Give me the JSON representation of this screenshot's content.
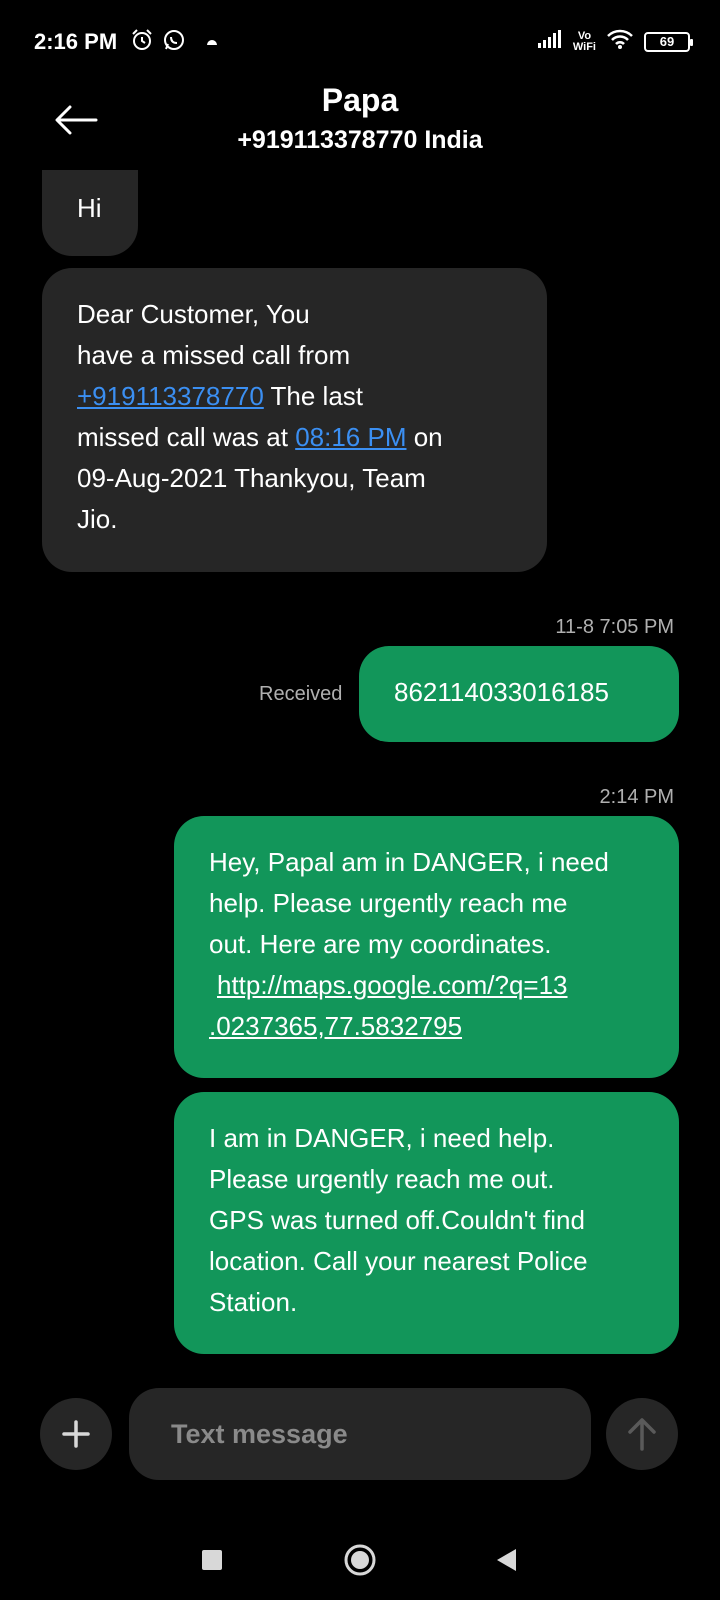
{
  "status_bar": {
    "time": "2:16 PM",
    "icons": [
      "alarm-icon",
      "whatsapp-icon",
      "notification-dot-icon",
      "signal-icon",
      "vowifi-icon",
      "wifi-icon",
      "battery-icon"
    ],
    "vowifi_label_top": "Vo",
    "vowifi_label_bottom": "WiFi",
    "battery_level": "69"
  },
  "header": {
    "contact_name": "Papa",
    "contact_number": "+919113378770 India",
    "back_icon": "arrow-left-icon"
  },
  "messages": {
    "incoming_1": {
      "text": "Hi"
    },
    "incoming_2": {
      "line1": "Dear Customer, You",
      "line2": "have a missed call from",
      "phone_link": "+919113378770",
      "line3_rest": " The last",
      "line4_start": "missed call was at ",
      "time_link": "08:16 PM",
      "line4_end": " on",
      "line5": "09-Aug-2021 Thankyou, Team",
      "line6": "Jio."
    },
    "timestamp_1": "11-8 7:05 PM",
    "outgoing_1": {
      "status": "Received",
      "text": "862114033016185"
    },
    "timestamp_2": "2:14 PM",
    "outgoing_2": {
      "line1": "Hey, Papal am in DANGER, i need",
      "line2": "help. Please urgently reach me",
      "line3": "out. Here are my coordinates.",
      "link_line1": "http://maps.google.com/?q=13",
      "link_line2": ".0237365,77.5832795"
    },
    "outgoing_3": {
      "line1": "I am in DANGER, i need help.",
      "line2": "Please urgently reach me out.",
      "line3": "GPS was turned off.Couldn't find",
      "line4": "location. Call your nearest Police",
      "line5": "Station."
    }
  },
  "compose": {
    "placeholder": "Text message",
    "add_icon": "plus-icon",
    "send_icon": "arrow-up-icon"
  },
  "nav_bar": {
    "icons": [
      "square-icon",
      "circle-icon",
      "triangle-back-icon"
    ]
  },
  "colors": {
    "background": "#000000",
    "incoming_bubble": "#262626",
    "outgoing_bubble": "#12965a",
    "link": "#3b8ff2",
    "secondary_text": "#b0b0b0"
  }
}
